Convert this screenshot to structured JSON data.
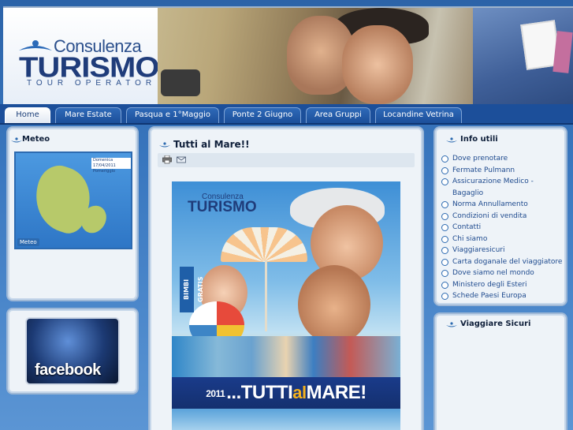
{
  "logo": {
    "line1": "Consulenza",
    "line2": "TURISMO",
    "line3": "TOUR OPERATOR"
  },
  "nav": {
    "tabs": [
      {
        "label": "Home",
        "active": true
      },
      {
        "label": "Mare Estate",
        "active": false
      },
      {
        "label": "Pasqua e 1°Maggio",
        "active": false
      },
      {
        "label": "Ponte 2 Giugno",
        "active": false
      },
      {
        "label": "Area Gruppi",
        "active": false
      },
      {
        "label": "Locandine Vetrina",
        "active": false
      }
    ]
  },
  "meteo": {
    "title": "Meteo",
    "date_label": "Domenica 17/04/2011",
    "date_sub": "Pomeriggio",
    "logo_text": "Meteo"
  },
  "facebook": {
    "label": "facebook"
  },
  "article": {
    "title": "Tutti al Mare!!",
    "poster": {
      "logo_line1": "Consulenza",
      "logo_line2": "TURISMO",
      "side_badge": "BIMBI GRATIS",
      "banner_year": "2011",
      "banner_pre": "...TUTTI",
      "banner_al": "al",
      "banner_post": "MARE!"
    }
  },
  "info": {
    "title": "Info utili",
    "items": [
      "Dove prenotare",
      "Fermate Pulmann",
      "Assicurazione Medico - Bagaglio",
      "Norma Annullamento",
      "Condizioni di vendita",
      "Contatti",
      "Chi siamo",
      "Viaggiaresicuri",
      "Carta doganale del viaggiatore",
      "Dove siamo nel mondo",
      "Ministero degli Esteri",
      "Schede Paesi Europa"
    ]
  },
  "viaggiare": {
    "title": "Viaggiare Sicuri"
  },
  "colors": {
    "nav_bg": "#1c4f9a",
    "panel_bg": "#eef3f8",
    "link": "#1e4a8e",
    "banner_accent": "#f6b21c"
  }
}
